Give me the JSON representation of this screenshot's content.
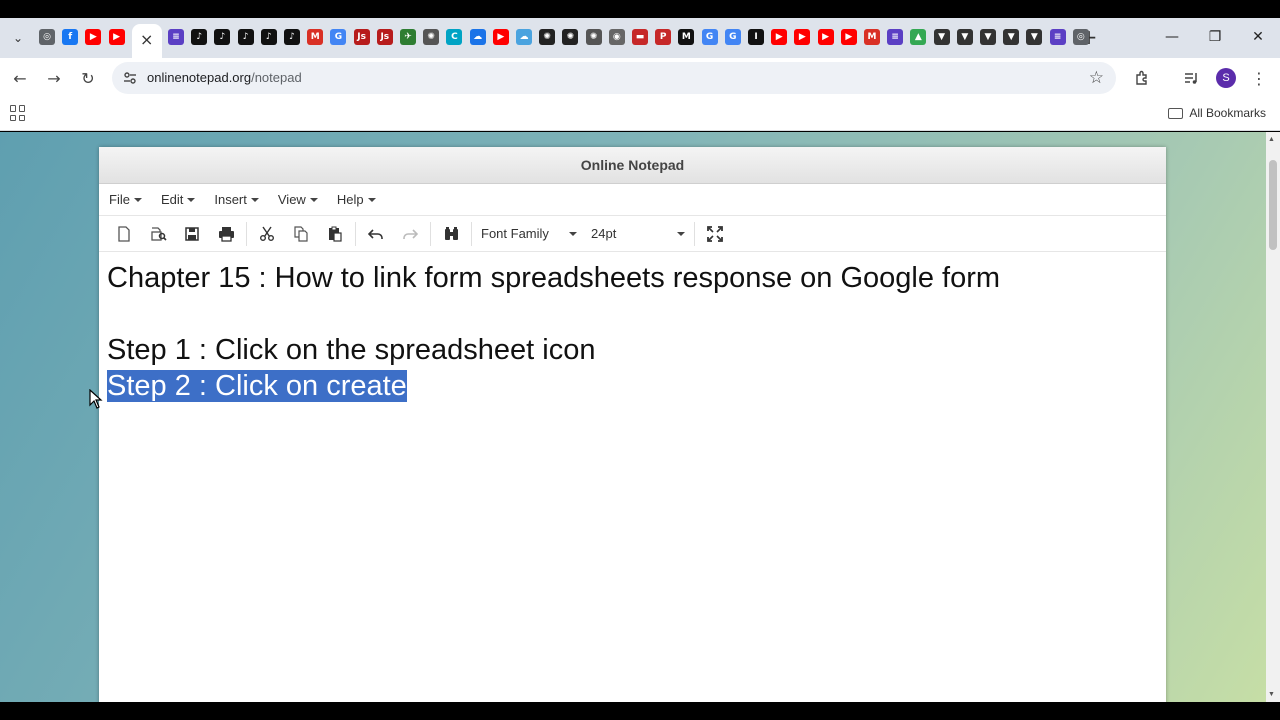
{
  "browser": {
    "tabs_icons": [
      {
        "name": "chrome-icon",
        "color": "#5f6368",
        "glyph": "◎"
      },
      {
        "name": "facebook-icon",
        "color": "#1877f2",
        "glyph": "f"
      },
      {
        "name": "youtube-icon",
        "color": "#ff0000",
        "glyph": "▶"
      },
      {
        "name": "youtube-icon",
        "color": "#ff0000",
        "glyph": "▶"
      }
    ],
    "tabs_icons_after": [
      {
        "name": "notes-icon",
        "color": "#5b3fc4",
        "glyph": "≡"
      },
      {
        "name": "tiktok-icon",
        "color": "#111111",
        "glyph": "♪"
      },
      {
        "name": "tiktok-icon",
        "color": "#111111",
        "glyph": "♪"
      },
      {
        "name": "tiktok-icon",
        "color": "#111111",
        "glyph": "♪"
      },
      {
        "name": "tiktok-icon",
        "color": "#111111",
        "glyph": "♪"
      },
      {
        "name": "tiktok-icon",
        "color": "#111111",
        "glyph": "♪"
      },
      {
        "name": "gmail-icon",
        "color": "#d93025",
        "glyph": "M"
      },
      {
        "name": "translate-icon",
        "color": "#4285f4",
        "glyph": "G"
      },
      {
        "name": "js-icon",
        "color": "#b71c1c",
        "glyph": "Js"
      },
      {
        "name": "js-icon",
        "color": "#b71c1c",
        "glyph": "Js"
      },
      {
        "name": "map-icon",
        "color": "#2e7d32",
        "glyph": "✈"
      },
      {
        "name": "openai-icon",
        "color": "#555555",
        "glyph": "✺"
      },
      {
        "name": "canva-icon",
        "color": "#00a3c4",
        "glyph": "C"
      },
      {
        "name": "cloud-icon",
        "color": "#1a73e8",
        "glyph": "☁"
      },
      {
        "name": "youtube-icon",
        "color": "#ff0000",
        "glyph": "▶"
      },
      {
        "name": "cloud-outline-icon",
        "color": "#4aa3df",
        "glyph": "☁"
      },
      {
        "name": "openai-icon",
        "color": "#222222",
        "glyph": "✺"
      },
      {
        "name": "openai-icon",
        "color": "#222222",
        "glyph": "✺"
      },
      {
        "name": "openai-icon",
        "color": "#555555",
        "glyph": "✺"
      },
      {
        "name": "globe-icon",
        "color": "#666666",
        "glyph": "◉"
      },
      {
        "name": "brand-icon",
        "color": "#c62828",
        "glyph": "▬"
      },
      {
        "name": "pdf-icon",
        "color": "#c62828",
        "glyph": "P"
      },
      {
        "name": "jm-icon",
        "color": "#111111",
        "glyph": "M"
      },
      {
        "name": "google-icon",
        "color": "#4285f4",
        "glyph": "G"
      },
      {
        "name": "google-icon",
        "color": "#4285f4",
        "glyph": "G"
      },
      {
        "name": "info-icon",
        "color": "#111111",
        "glyph": "I"
      },
      {
        "name": "youtube-icon",
        "color": "#ff0000",
        "glyph": "▶"
      },
      {
        "name": "youtube-icon",
        "color": "#ff0000",
        "glyph": "▶"
      },
      {
        "name": "youtube-icon",
        "color": "#ff0000",
        "glyph": "▶"
      },
      {
        "name": "youtube-icon",
        "color": "#ff0000",
        "glyph": "▶"
      },
      {
        "name": "gmail-icon",
        "color": "#d93025",
        "glyph": "M"
      },
      {
        "name": "notes-icon",
        "color": "#5b3fc4",
        "glyph": "≡"
      },
      {
        "name": "drive-icon",
        "color": "#34a853",
        "glyph": "▲"
      },
      {
        "name": "vpn-icon",
        "color": "#333333",
        "glyph": "▼"
      },
      {
        "name": "vpn-icon",
        "color": "#333333",
        "glyph": "▼"
      },
      {
        "name": "vpn-icon",
        "color": "#333333",
        "glyph": "▼"
      },
      {
        "name": "vpn-icon",
        "color": "#333333",
        "glyph": "▼"
      },
      {
        "name": "vpn-icon",
        "color": "#333333",
        "glyph": "▼"
      },
      {
        "name": "notes-icon",
        "color": "#5b3fc4",
        "glyph": "≡"
      },
      {
        "name": "chrome-icon",
        "color": "#5f6368",
        "glyph": "◎"
      }
    ],
    "active_tab_close": "×",
    "new_tab": "+",
    "url_domain": "onlinenotepad.org",
    "url_path": "/notepad",
    "avatar_letter": "S",
    "all_bookmarks_label": "All Bookmarks"
  },
  "notepad": {
    "title": "Online Notepad",
    "menu": [
      "File",
      "Edit",
      "Insert",
      "View",
      "Help"
    ],
    "font_family_label": "Font Family",
    "font_size_label": "24pt",
    "lines": [
      {
        "text": "Chapter 15 : How to link form spreadsheets response on Google form",
        "selected": false
      },
      {
        "text": "",
        "selected": false
      },
      {
        "text": "Step 1 : Click on the spreadsheet icon",
        "selected": false
      },
      {
        "text": "Step 2 : Click on create",
        "selected": true
      }
    ]
  },
  "colors": {
    "selection": "#3d6fc7",
    "avatar": "#5b2cab"
  }
}
